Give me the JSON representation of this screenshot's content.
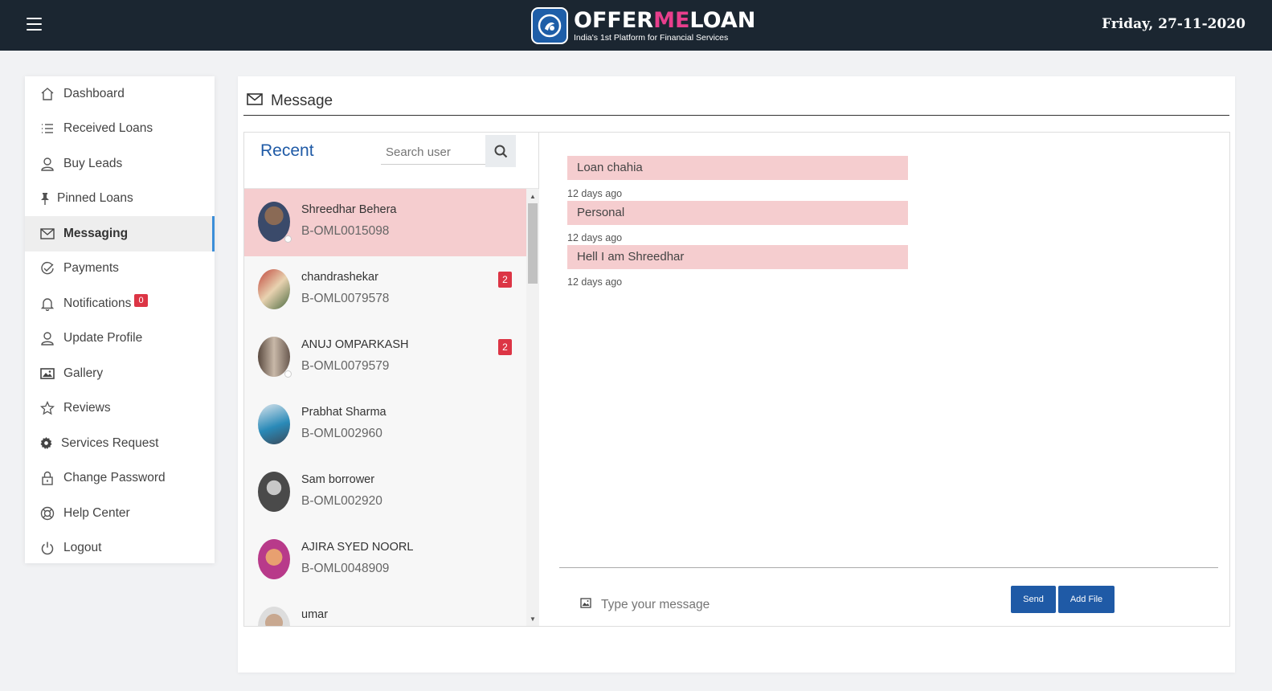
{
  "header": {
    "brand_prefix": "OFFER",
    "brand_mid": "ME",
    "brand_suffix": "LOAN",
    "tagline": "India's 1st Platform for Financial Services",
    "date": "Friday, 27-11-2020"
  },
  "sidebar": {
    "items": [
      {
        "label": "Dashboard",
        "icon": "home-icon"
      },
      {
        "label": "Received Loans",
        "icon": "list-icon"
      },
      {
        "label": "Buy Leads",
        "icon": "user-icon"
      },
      {
        "label": "Pinned Loans",
        "icon": "pin-icon"
      },
      {
        "label": "Messaging",
        "icon": "envelope-icon",
        "active": true
      },
      {
        "label": "Payments",
        "icon": "check-circle-icon"
      },
      {
        "label": "Notifications",
        "icon": "bell-icon",
        "badge": "0"
      },
      {
        "label": "Update Profile",
        "icon": "user-icon"
      },
      {
        "label": "Gallery",
        "icon": "image-icon"
      },
      {
        "label": "Reviews",
        "icon": "star-icon"
      },
      {
        "label": "Services Request",
        "icon": "gear-icon"
      },
      {
        "label": "Change Password",
        "icon": "lock-icon"
      },
      {
        "label": "Help Center",
        "icon": "lifebuoy-icon"
      },
      {
        "label": "Logout",
        "icon": "power-icon"
      }
    ]
  },
  "main": {
    "title": "Message"
  },
  "users": {
    "heading": "Recent",
    "search_placeholder": "Search user",
    "list": [
      {
        "name": "Shreedhar Behera",
        "id": "B-OML0015098",
        "selected": true,
        "unread": ""
      },
      {
        "name": "chandrashekar",
        "id": "B-OML0079578",
        "unread": "2"
      },
      {
        "name": "ANUJ OMPARKASH",
        "id": "B-OML0079579",
        "unread": "2"
      },
      {
        "name": "Prabhat Sharma",
        "id": "B-OML002960",
        "unread": ""
      },
      {
        "name": "Sam borrower",
        "id": "B-OML002920",
        "unread": ""
      },
      {
        "name": "AJIRA SYED NOORL",
        "id": "B-OML0048909",
        "unread": ""
      },
      {
        "name": "umar",
        "id": "",
        "unread": ""
      }
    ]
  },
  "chat": {
    "messages": [
      {
        "text": "Loan chahia",
        "time": "12 days ago"
      },
      {
        "text": "Personal",
        "time": "12 days ago"
      },
      {
        "text": "Hell I am Shreedhar",
        "time": "12 days ago"
      }
    ],
    "input_placeholder": "Type your message",
    "send_label": "Send",
    "add_file_label": "Add File"
  },
  "colors": {
    "topbar": "#1b2631",
    "accent": "#1f5aa6",
    "brand_pink": "#e83e8c",
    "highlight": "#f5cdcf",
    "badge": "#dc3545"
  }
}
